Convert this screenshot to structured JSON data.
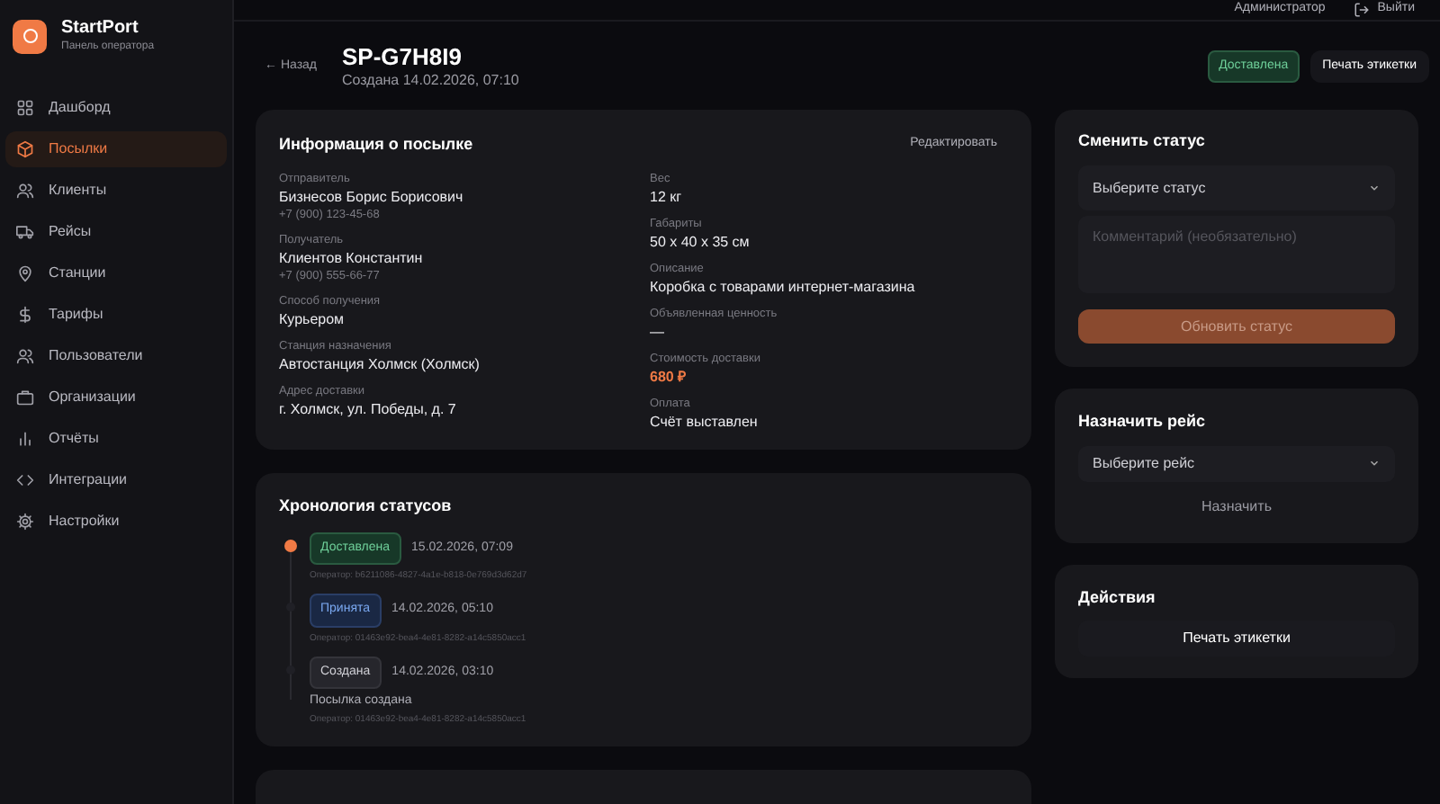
{
  "brand": {
    "name": "StartPort",
    "subtitle": "Панель оператора"
  },
  "sidebar": {
    "items": [
      {
        "label": "Дашборд",
        "kind": "grid",
        "selected": false
      },
      {
        "label": "Посылки",
        "kind": "box",
        "selected": true
      },
      {
        "label": "Клиенты",
        "kind": "users",
        "selected": false
      },
      {
        "label": "Рейсы",
        "kind": "truck",
        "selected": false
      },
      {
        "label": "Станции",
        "kind": "pin",
        "selected": false
      },
      {
        "label": "Тарифы",
        "kind": "dollar",
        "selected": false
      },
      {
        "label": "Пользователи",
        "kind": "users",
        "selected": false
      },
      {
        "label": "Организации",
        "kind": "briefcase",
        "selected": false
      },
      {
        "label": "Отчёты",
        "kind": "bars",
        "selected": false
      },
      {
        "label": "Интеграции",
        "kind": "code",
        "selected": false
      },
      {
        "label": "Настройки",
        "kind": "gear",
        "selected": false
      }
    ]
  },
  "topbar": {
    "user": "Администратор",
    "logout": "Выйти"
  },
  "header": {
    "back": "← Назад",
    "title": "SP-G7H8I9",
    "created": "Создана 14.02.2026, 07:10",
    "status_badge": "Доставлена",
    "print_button": "Печать этикетки"
  },
  "info": {
    "title": "Информация о посылке",
    "edit": "Редактировать",
    "left": [
      {
        "label": "Отправитель",
        "value": "Бизнесов Борис Борисович",
        "sub": "+7 (900) 123-45-68"
      },
      {
        "label": "Получатель",
        "value": "Клиентов Константин",
        "sub": "+7 (900) 555-66-77"
      },
      {
        "label": "Способ получения",
        "value": "Курьером"
      },
      {
        "label": "Станция назначения",
        "value": "Автостанция Холмск (Холмск)"
      },
      {
        "label": "Адрес доставки",
        "value": "г. Холмск, ул. Победы, д. 7"
      }
    ],
    "right": [
      {
        "label": "Вес",
        "value": "12 кг"
      },
      {
        "label": "Габариты",
        "value": "50 x 40 x 35 см"
      },
      {
        "label": "Описание",
        "value": "Коробка с товарами интернет-магазина"
      },
      {
        "label": "Объявленная ценность",
        "value": "—"
      },
      {
        "label": "Стоимость доставки",
        "value": "680 ₽",
        "kind": "accent"
      },
      {
        "label": "Оплата",
        "value": "Счёт выставлен"
      }
    ]
  },
  "timeline": {
    "title": "Хронология статусов",
    "events": [
      {
        "status": "Доставлена",
        "kind": "delivered",
        "time": "15.02.2026, 07:09",
        "operator": "Оператор: b6211086-4827-4a1e-b818-0e769d3d62d7",
        "selected": true
      },
      {
        "status": "Принята",
        "kind": "accepted",
        "time": "14.02.2026, 05:10",
        "operator": "Оператор: 01463e92-bea4-4e81-8282-a14c5850acc1",
        "selected": false
      },
      {
        "status": "Создана",
        "kind": "created",
        "time": "14.02.2026, 03:10",
        "note": "Посылка создана",
        "operator": "Оператор: 01463e92-bea4-4e81-8282-a14c5850acc1",
        "selected": false
      }
    ]
  },
  "change_status": {
    "title": "Сменить статус",
    "select": "Выберите статус",
    "comment_placeholder": "Комментарий (необязательно)",
    "button": "Обновить статус"
  },
  "assign_trip": {
    "title": "Назначить рейс",
    "select": "Выберите рейс",
    "button": "Назначить"
  },
  "actions": {
    "title": "Действия",
    "button": "Печать этикетки"
  }
}
